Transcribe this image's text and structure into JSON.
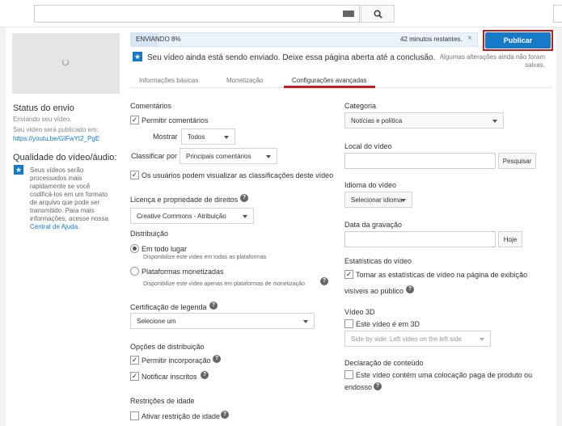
{
  "topbar": {
    "search_placeholder": ""
  },
  "left": {
    "upload_status_title": "Status do envio",
    "upload_status_text": "Enviando seu vídeo.",
    "publish_at_label": "Seu vídeo será publicado em:",
    "video_link": "https://youtu.be/GlFwYt2_PgE",
    "quality_title": "Qualidade do vídeo/áudio:",
    "quality_text_pre": "Seus vídeos serão processados mais rapidamente se você codificá-los em um formato de arquivo que pode ser transmitido. Para mais informações, acesse nossa ",
    "help_center_link": "Central de Ajuda",
    "quality_text_post": "."
  },
  "progress": {
    "label": "ENVIANDO 8%",
    "percent": 8,
    "time_remaining": "42 minutos restantes.",
    "close": "×"
  },
  "notice": "Seu vídeo ainda está sendo enviado. Deixe essa página aberta até a conclusão.",
  "publish": {
    "label": "Publicar",
    "note": "Algumas alterações ainda não foram salvas."
  },
  "tabs": [
    {
      "label": "Informações básicas",
      "active": false
    },
    {
      "label": "Monetização",
      "active": false
    },
    {
      "label": "Configurações avançadas",
      "active": true
    }
  ],
  "comments": {
    "title": "Comentários",
    "allow_label": "Permitir comentários",
    "allow_checked": true,
    "show_label": "Mostrar",
    "show_value": "Todos",
    "sort_label": "Classificar por",
    "sort_value": "Principais comentários",
    "ratings_label": "Os usuários podem visualizar as classificações deste vídeo",
    "ratings_checked": true
  },
  "license": {
    "title": "Licença e propriedade de direitos",
    "value": "Creative Commons - Atribuição"
  },
  "distribution": {
    "title": "Distribuição",
    "everywhere_label": "Em todo lugar",
    "everywhere_desc": "Disponibilize este vídeo em todas as plataformas",
    "monetized_label": "Plataformas monetizadas",
    "monetized_desc": "Disponibilize este vídeo apenas em plataformas de monetização"
  },
  "caption_cert": {
    "title": "Certificação de legenda",
    "value": "Selecione um"
  },
  "distribution_options": {
    "title": "Opções de distribuição",
    "embed_label": "Permitir incorporação",
    "notify_label": "Notificar inscritos"
  },
  "age": {
    "title": "Restrições de idade",
    "enable_label": "Ativar restrição de idade"
  },
  "category": {
    "title": "Categoria",
    "value": "Notícias e política"
  },
  "location": {
    "title": "Local do vídeo",
    "search_label": "Pesquisar"
  },
  "language": {
    "title": "Idioma do vídeo",
    "value": "Selecionar idioma"
  },
  "recording_date": {
    "title": "Data da gravação",
    "today_label": "Hoje"
  },
  "stats": {
    "title": "Estatísticas do vídeo",
    "label_line1": "Tornar as estatísticas de vídeo na página de exibição",
    "label_line2": "visíveis ao público"
  },
  "video3d": {
    "title": "Vídeo 3D",
    "is3d_label": "Este vídeo é em 3D",
    "mode_value": "Side by side: Left video on the left side"
  },
  "content_decl": {
    "title": "Declaração de conteúdo",
    "label_line1": "Este vídeo contém uma colocação paga de produto ou",
    "label_line2": "endosso"
  },
  "colors": {
    "accent": "#167ac6",
    "tab_underline": "#cc181e",
    "publish_outline": "#cc1a1a"
  }
}
